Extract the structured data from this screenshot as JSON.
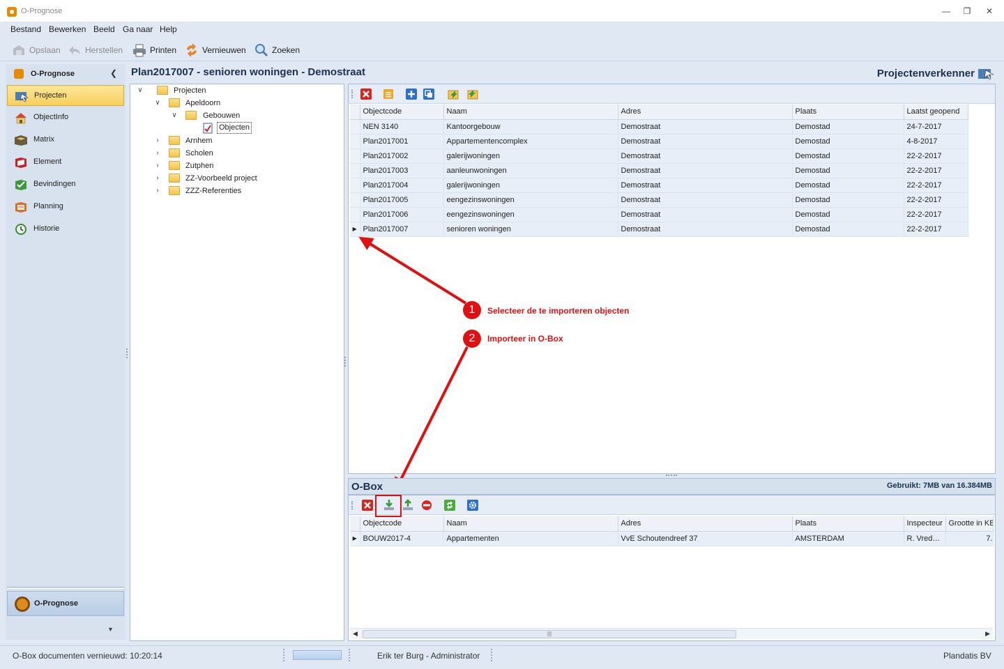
{
  "window": {
    "title": "O-Prognose"
  },
  "menu": [
    "Bestand",
    "Bewerken",
    "Beeld",
    "Ga naar",
    "Help"
  ],
  "toolbar": {
    "save": "Opslaan",
    "restore": "Herstellen",
    "print": "Printen",
    "refresh": "Vernieuwen",
    "search": "Zoeken"
  },
  "nav": {
    "header": "O-Prognose",
    "items": [
      {
        "label": "Projecten",
        "icon": "projects-icon",
        "active": true
      },
      {
        "label": "ObjectInfo",
        "icon": "house-icon"
      },
      {
        "label": "Matrix",
        "icon": "matrix-icon"
      },
      {
        "label": "Element",
        "icon": "element-icon"
      },
      {
        "label": "Bevindingen",
        "icon": "findings-icon"
      },
      {
        "label": "Planning",
        "icon": "planning-icon"
      },
      {
        "label": "Historie",
        "icon": "history-icon"
      }
    ],
    "bottom": "O-Prognose"
  },
  "page": {
    "title": "Plan2017007 - senioren woningen - Demostraat",
    "explorer": "Projectenverkenner"
  },
  "tree": [
    {
      "label": "Projecten",
      "expanded": true
    },
    {
      "label": "Apeldoorn",
      "expanded": true
    },
    {
      "label": "Gebouwen",
      "expanded": true
    },
    {
      "label": "Objecten",
      "selected": true
    },
    {
      "label": "Arnhem"
    },
    {
      "label": "Scholen"
    },
    {
      "label": "Zutphen"
    },
    {
      "label": "ZZ-Voorbeeld project"
    },
    {
      "label": "ZZZ-Referenties"
    }
  ],
  "projects_grid": {
    "columns": [
      "Objectcode",
      "Naam",
      "Adres",
      "Plaats",
      "Laatst geopend"
    ],
    "rows": [
      [
        "NEN 3140",
        "Kantoorgebouw",
        "Demostraat",
        "Demostad",
        "24-7-2017"
      ],
      [
        "Plan2017001",
        "Appartementencomplex",
        "Demostraat",
        "Demostad",
        "4-8-2017"
      ],
      [
        "Plan2017002",
        "galerijwoningen",
        "Demostraat",
        "Demostad",
        "22-2-2017"
      ],
      [
        "Plan2017003",
        "aanleunwoningen",
        "Demostraat",
        "Demostad",
        "22-2-2017"
      ],
      [
        "Plan2017004",
        "galerijwoningen",
        "Demostraat",
        "Demostad",
        "22-2-2017"
      ],
      [
        "Plan2017005",
        "eengezinswoningen",
        "Demostraat",
        "Demostad",
        "22-2-2017"
      ],
      [
        "Plan2017006",
        "eengezinswoningen",
        "Demostraat",
        "Demostad",
        "22-2-2017"
      ],
      [
        "Plan2017007",
        "senioren woningen",
        "Demostraat",
        "Demostad",
        "22-2-2017"
      ]
    ],
    "current_row": 7
  },
  "annotations": [
    {
      "number": "1",
      "text": "Selecteer de te importeren objecten"
    },
    {
      "number": "2",
      "text": "Importeer in O-Box"
    }
  ],
  "obox": {
    "title": "O-Box",
    "usage": "Gebruikt: 7MB van 16.384MB",
    "columns": [
      "Objectcode",
      "Naam",
      "Adres",
      "Plaats",
      "Inspecteur",
      "Grootte in KB"
    ],
    "rows": [
      [
        "BOUW2017-4",
        "Appartementen",
        "VvE Schoutendreef 37",
        "AMSTERDAM",
        "R. Vred…",
        "7."
      ]
    ]
  },
  "status": {
    "left": "O-Box documenten vernieuwd: 10:20:14",
    "user": "Erik ter Burg - Administrator",
    "company": "Plandatis BV"
  },
  "colors": {
    "annotation": "#e01010",
    "active_nav": "#f7cf5c",
    "window_bg": "#dfe8f3"
  }
}
